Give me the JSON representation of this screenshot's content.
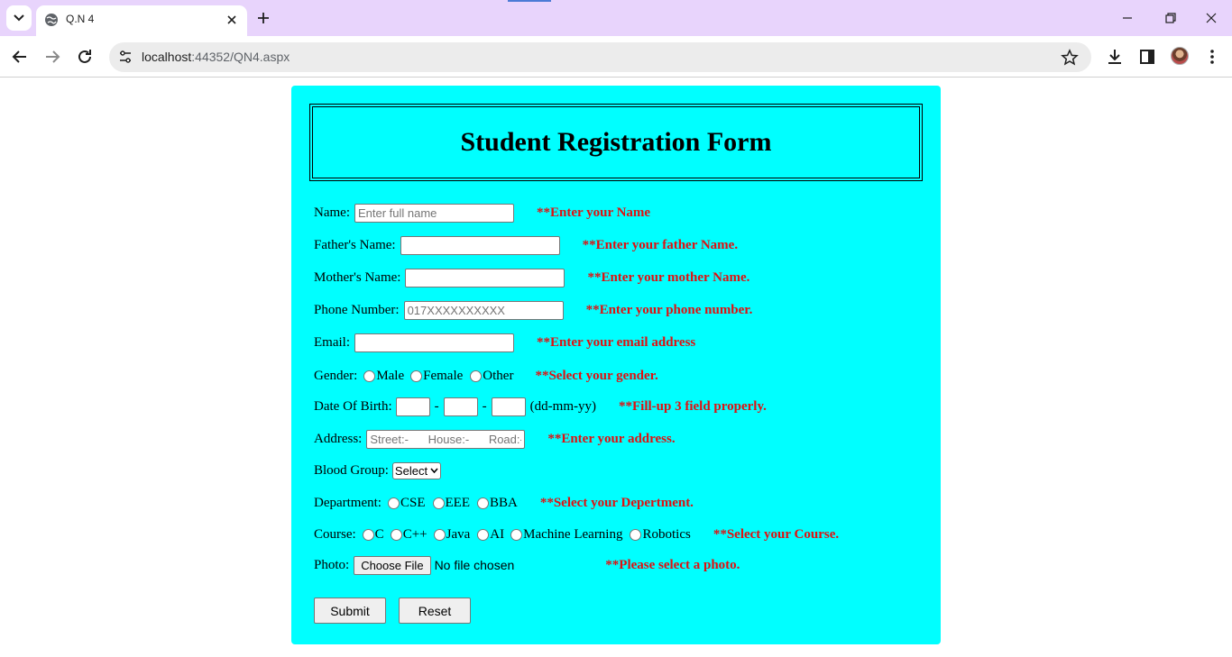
{
  "browser": {
    "tab_title": "Q.N 4",
    "url_host": "localhost",
    "url_path": ":44352/QN4.aspx"
  },
  "form": {
    "title": "Student Registration Form",
    "name": {
      "label": "Name:",
      "placeholder": "Enter full name",
      "error": "**Enter your Name"
    },
    "father": {
      "label": "Father's Name:",
      "error": "**Enter your father Name."
    },
    "mother": {
      "label": "Mother's Name:",
      "error": "**Enter your mother Name."
    },
    "phone": {
      "label": "Phone Number:",
      "placeholder": "017XXXXXXXXXX",
      "error": "**Enter your phone number."
    },
    "email": {
      "label": "Email:",
      "error": "**Enter your email address"
    },
    "gender": {
      "label": "Gender:",
      "options": [
        "Male",
        "Female",
        "Other"
      ],
      "error": "**Select your gender."
    },
    "dob": {
      "label": "Date Of Birth:",
      "sep": "-",
      "format": "(dd-mm-yy)",
      "error": "**Fill-up 3 field properly."
    },
    "address": {
      "label": "Address:",
      "placeholder": "Street:-      House:-      Road:-",
      "error": "**Enter your address."
    },
    "blood": {
      "label": "Blood Group:",
      "selected": "Select"
    },
    "department": {
      "label": "Department:",
      "options": [
        "CSE",
        "EEE",
        "BBA"
      ],
      "error": "**Select your Depertment."
    },
    "course": {
      "label": "Course:",
      "options": [
        "C",
        "C++",
        "Java",
        "AI",
        "Machine Learning",
        "Robotics"
      ],
      "error": "**Select your Course."
    },
    "photo": {
      "label": "Photo:",
      "button": "Choose File",
      "status": "No file chosen",
      "error": "**Please select a photo."
    },
    "submit": "Submit",
    "reset": "Reset"
  },
  "icons": [
    "tab-search-icon",
    "globe-icon",
    "close-icon",
    "plus-icon",
    "minimize-icon",
    "restore-icon",
    "back-arrow-icon",
    "forward-arrow-icon",
    "reload-icon",
    "tune-icon",
    "star-icon",
    "download-icon",
    "side-panel-icon",
    "more-vert-icon"
  ]
}
